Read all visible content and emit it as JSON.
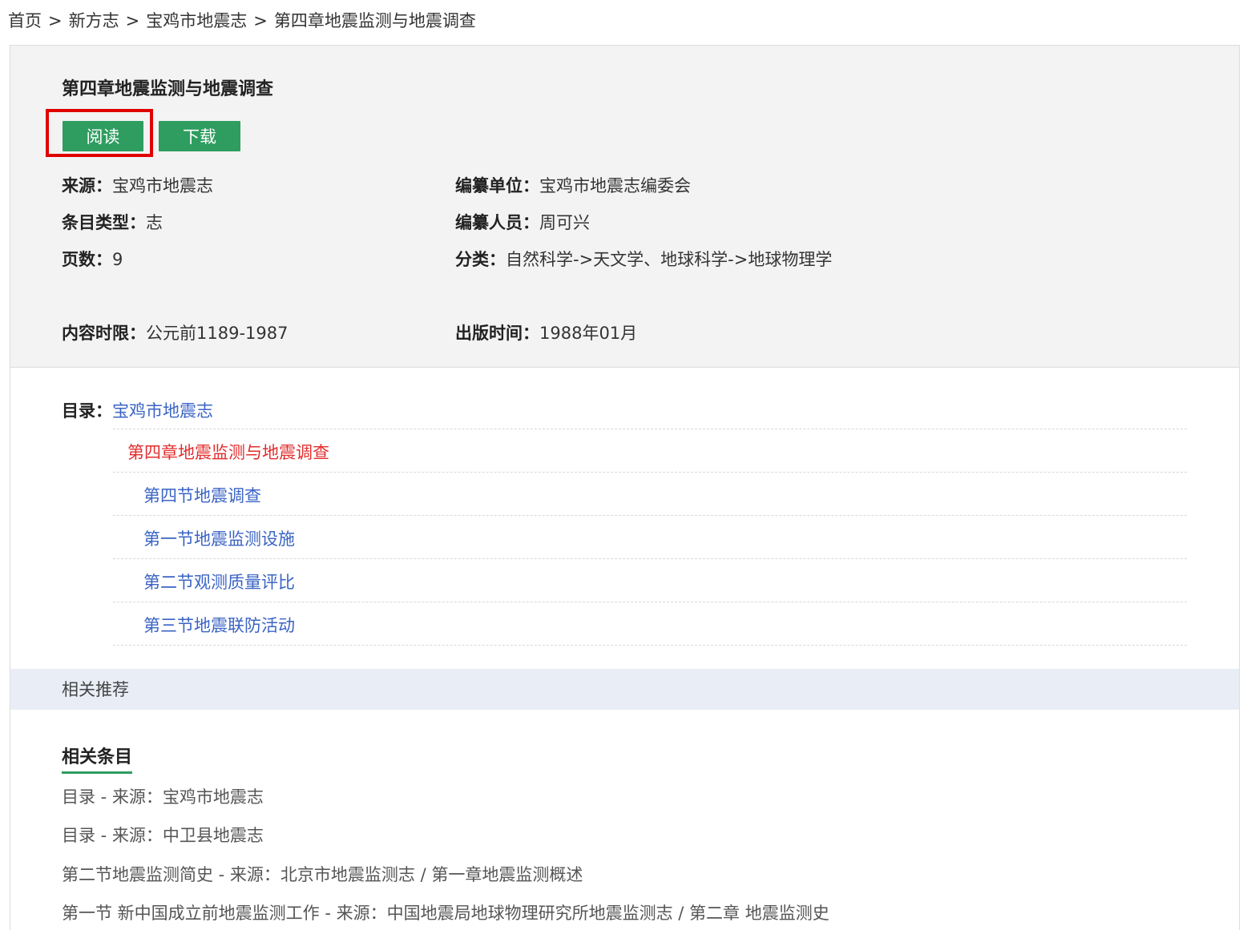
{
  "breadcrumb": {
    "home": "首页",
    "sep": ">",
    "level1": "新方志",
    "level2": "宝鸡市地震志",
    "current": "第四章地震监测与地震调查"
  },
  "record": {
    "title": "第四章地震监测与地震调查",
    "read_label": "阅读",
    "download_label": "下载",
    "source_label": "来源：",
    "source_value": "宝鸡市地震志",
    "editor_unit_label": "编纂单位：",
    "editor_unit_value": "宝鸡市地震志编委会",
    "type_label": "条目类型：",
    "type_value": "志",
    "editor_person_label": "编纂人员：",
    "editor_person_value": "周可兴",
    "pages_label": "页数：",
    "pages_value": "9",
    "category_label": "分类：",
    "category_value": "自然科学->天文学、地球科学->地球物理学",
    "period_label": "内容时限：",
    "period_value": "公元前1189-1987",
    "pubdate_label": "出版时间：",
    "pubdate_value": "1988年01月"
  },
  "toc": {
    "label": "目录：",
    "root": "宝鸡市地震志",
    "current": "第四章地震监测与地震调查",
    "items": [
      "第四节地震调查",
      "第一节地震监测设施",
      "第二节观测质量评比",
      "第三节地震联防活动"
    ]
  },
  "recommend": {
    "bar_label": "相关推荐",
    "section_title": "相关条目",
    "items": [
      "目录 - 来源：宝鸡市地震志",
      "目录 - 来源：中卫县地震志",
      "第二节地震监测简史 - 来源：北京市地震监测志 / 第一章地震监测概述",
      "第一节 新中国成立前地震监测工作 - 来源：中国地震局地球物理研究所地震监测志 / 第二章 地震监测史"
    ]
  },
  "colors": {
    "button_green": "#2e9d5f",
    "highlight_red": "#e00000",
    "link_blue": "#3b64c4",
    "current_red": "#e22d2d"
  }
}
